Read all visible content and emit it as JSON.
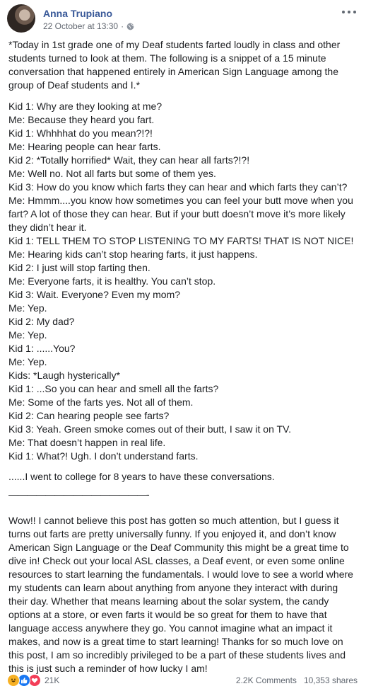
{
  "post": {
    "author": "Anna Trupiano",
    "date": "22 October at 13:30",
    "separator": "·",
    "privacy_icon": "globe-icon",
    "menu_icon": "more-options-icon",
    "intro": "*Today in 1st grade one of my Deaf students farted loudly in class and other students turned to look at them. The following is a snippet of a 15 minute conversation that happened entirely in American Sign Language among the group of Deaf students and I.*",
    "dialogue": [
      "Kid 1: Why are they looking at me?",
      "Me: Because they heard you fart.",
      "Kid 1: Whhhhat do you mean?!?!",
      "Me: Hearing people can hear farts.",
      "Kid 2: *Totally horrified* Wait, they can hear all farts?!?!",
      "Me: Well no. Not all farts but some of them yes.",
      "Kid 3: How do you know which farts they can hear and which farts they can’t?",
      "Me: Hmmm....you know how sometimes you can feel your butt move when you fart? A lot of those they can hear. But if your butt doesn’t move it’s more likely they didn’t hear it.",
      "Kid 1: TELL THEM TO STOP LISTENING TO MY FARTS! THAT IS NOT NICE!",
      "Me: Hearing kids can’t stop hearing farts, it just happens.",
      "Kid 2: I just will stop farting then.",
      "Me: Everyone farts, it is healthy. You can’t stop.",
      "Kid 3: Wait. Everyone? Even my mom?",
      "Me: Yep.",
      "Kid 2: My dad?",
      "Me: Yep.",
      "Kid 1: ......You?",
      "Me: Yep.",
      "Kids: *Laugh hysterically*",
      "Kid 1: ...So you can hear and smell all the farts?",
      "Me: Some of the farts yes. Not all of them.",
      "Kid 2: Can hearing people see farts?",
      "Kid 3: Yeah. Green smoke comes out of their butt, I saw it on TV.",
      "Me: That doesn’t happen in real life.",
      "Kid 1: What?! Ugh. I don’t understand farts."
    ],
    "closing": "......I went to college for 8 years to have these conversations.",
    "divider": "———————————————-",
    "update": "Wow!! I cannot believe this post has gotten so much attention, but I guess it turns out farts are pretty universally funny. If you enjoyed it, and don’t know American Sign Language or the Deaf Community this might be a great time to dive in! Check out your local ASL classes, a Deaf event, or even some online resources to start learning the fundamentals. I would love to see a world where my students can learn about anything from anyone they interact with during their day. Whether that means learning about the solar system, the candy options at a store, or even farts it would be so great for them to have that language access anywhere they go. You cannot imagine what an impact it makes, and now is a great time to start learning! Thanks for so much love on this post, I am so incredibly privileged to be a part of these students lives and this is just such a reminder of how lucky I am!"
  },
  "footer": {
    "reactions": [
      "haha-reaction-icon",
      "like-reaction-icon",
      "love-reaction-icon"
    ],
    "reaction_count": "21K",
    "comments": "2.2K Comments",
    "shares": "10,353 shares"
  },
  "colors": {
    "author_link": "#385898",
    "meta": "#616770",
    "text": "#1c1e21",
    "like": "#1877f2",
    "love": "#f33e58",
    "haha": "#f7b125"
  }
}
